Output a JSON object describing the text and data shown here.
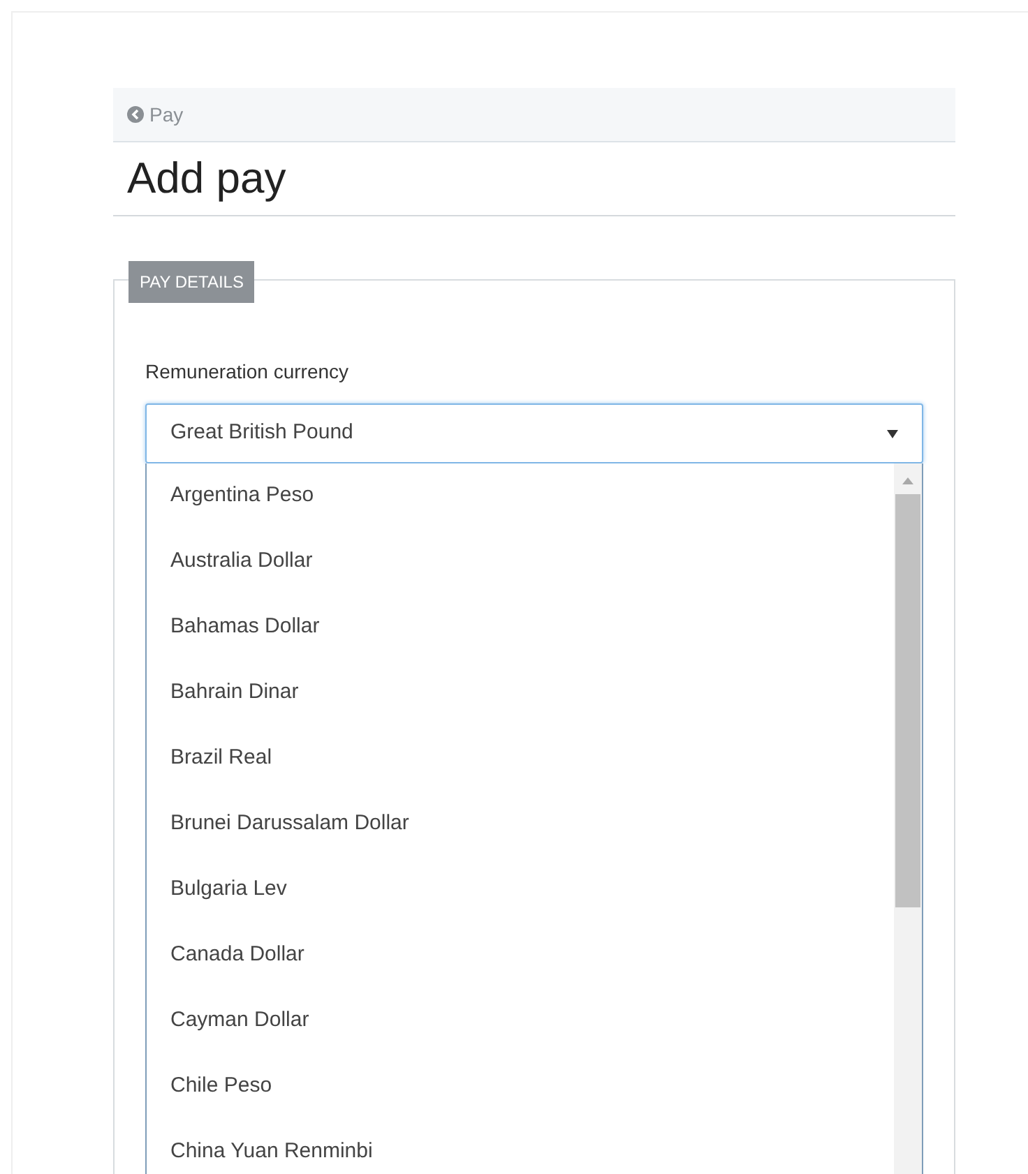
{
  "breadcrumb": {
    "label": "Pay"
  },
  "title": "Add pay",
  "section": {
    "legend": "PAY DETAILS"
  },
  "currency_field": {
    "label": "Remuneration currency",
    "value": "Great British Pound",
    "expanded": true,
    "options": [
      {
        "label": "Argentina Peso"
      },
      {
        "label": "Australia Dollar"
      },
      {
        "label": "Bahamas Dollar"
      },
      {
        "label": "Bahrain Dinar"
      },
      {
        "label": "Brazil Real"
      },
      {
        "label": "Brunei Darussalam Dollar"
      },
      {
        "label": "Bulgaria Lev"
      },
      {
        "label": "Canada Dollar"
      },
      {
        "label": "Cayman Dollar"
      },
      {
        "label": "Chile Peso"
      },
      {
        "label": "China Yuan Renminbi"
      }
    ]
  }
}
